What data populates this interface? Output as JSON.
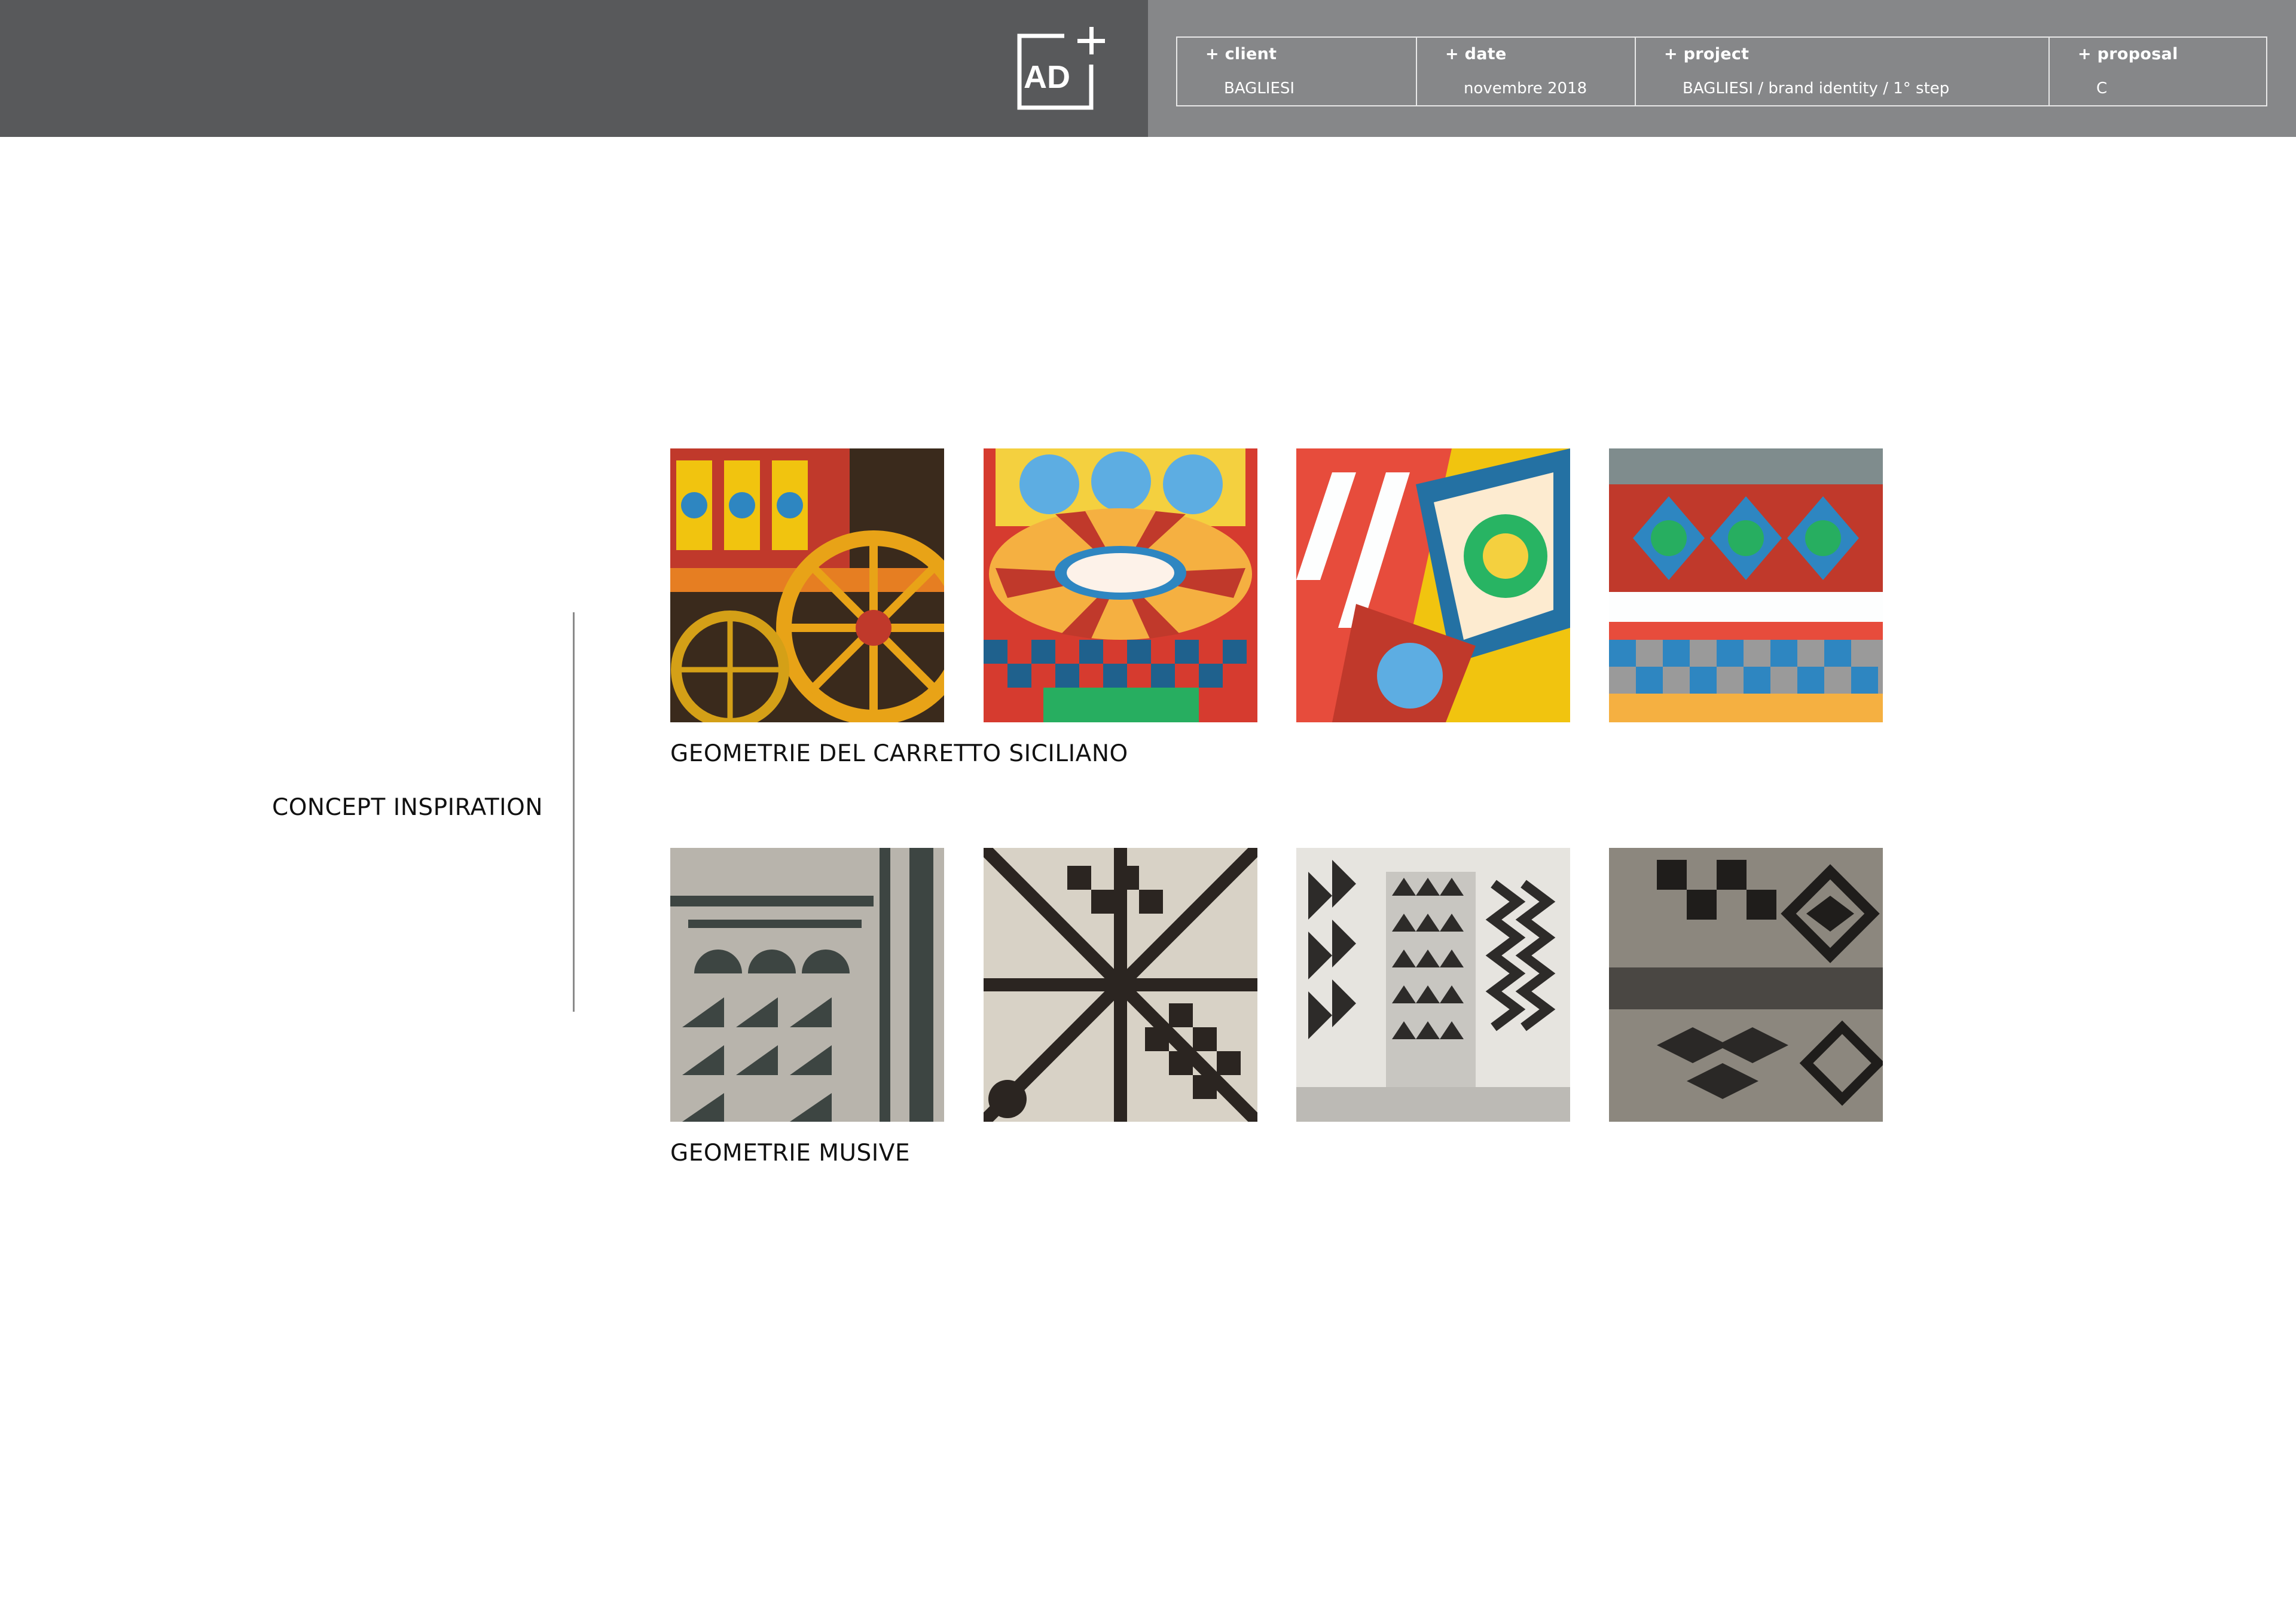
{
  "header": {
    "logo_text": "AD",
    "info": [
      {
        "label": "+ client",
        "value": "BAGLIESI"
      },
      {
        "label": "+ date",
        "value": "novembre 2018"
      },
      {
        "label": "+ project",
        "value": "BAGLIESI / brand identity / 1° step"
      },
      {
        "label": "+ proposal",
        "value": "C"
      }
    ]
  },
  "main": {
    "title": "CONCEPT INSPIRATION",
    "sections": [
      {
        "label": "GEOMETRIE DEL CARRETTO SICILIANO",
        "images": [
          "carretto-wheel-photo",
          "carretto-floor-photo",
          "carretto-panels-photo",
          "carretto-interior-photo"
        ]
      },
      {
        "label": "GEOMETRIE MUSIVE",
        "images": [
          "mosaic-border-photo",
          "mosaic-star-photo",
          "mosaic-zigzag-photo",
          "mosaic-diamond-photo"
        ]
      }
    ]
  },
  "colors": {
    "header_dark": "#58595b",
    "header_light": "#868789",
    "text": "#111111",
    "divider": "#8a8a8a"
  }
}
